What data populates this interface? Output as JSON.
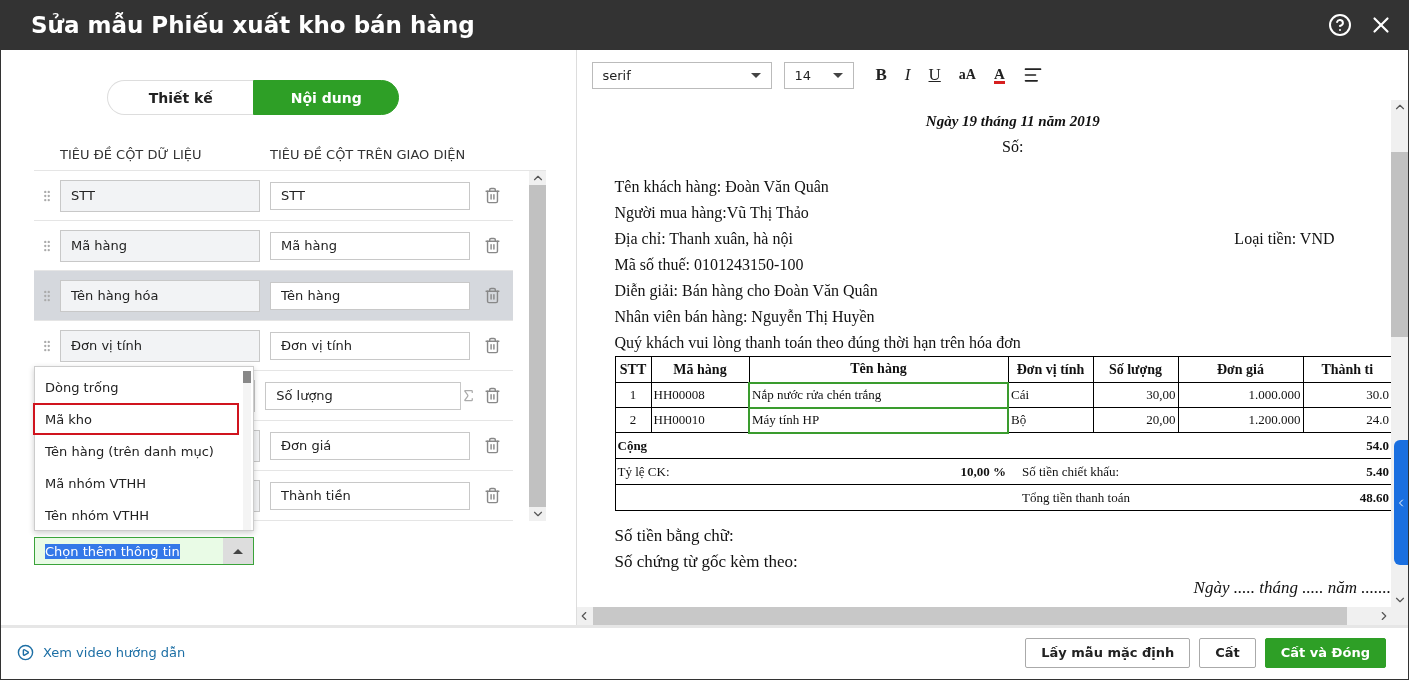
{
  "window": {
    "title": "Sửa mẫu Phiếu xuất kho bán hàng"
  },
  "mode_tabs": [
    {
      "label": "Thiết kế",
      "selected": false
    },
    {
      "label": "Nội dung",
      "selected": true
    }
  ],
  "column_headers": [
    "TIÊU ĐỀ CỘT DỮ LIỆU",
    "TIÊU ĐỀ CỘT TRÊN GIAO DIỆN"
  ],
  "rows": [
    {
      "data_field": "STT",
      "display_title": "STT",
      "selected": false,
      "sum": false
    },
    {
      "data_field": "Mã hàng",
      "display_title": "Mã hàng",
      "selected": false,
      "sum": false
    },
    {
      "data_field": "Tên hàng hóa",
      "display_title": "Tên hàng",
      "selected": true,
      "sum": false
    },
    {
      "data_field": "Đơn vị tính",
      "display_title": "Đơn vị tính",
      "selected": false,
      "sum": false
    },
    {
      "display_title": "Số lượng",
      "selected": false,
      "sum": true
    },
    {
      "display_title": "Đơn giá",
      "selected": false,
      "sum": false
    },
    {
      "display_title": "Thành tiền",
      "selected": false,
      "sum": false
    }
  ],
  "dropdown": {
    "options": [
      {
        "label": "Dòng trống",
        "selected": false
      },
      {
        "label": "Mã kho",
        "selected": true
      },
      {
        "label": "Tên hàng (trên danh mục)",
        "selected": false
      },
      {
        "label": "Mã nhóm VTHH",
        "selected": false
      },
      {
        "label": "Tên nhóm VTHH",
        "selected": false
      }
    ],
    "value": "Chọn thêm thông tin",
    "text_selected": true
  },
  "video_link": "Xem video hướng dẫn",
  "editor": {
    "font": "serif",
    "size": "14",
    "format_buttons": [
      {
        "kind": "bold",
        "label": "B"
      },
      {
        "kind": "italic",
        "label": "I"
      },
      {
        "kind": "underline",
        "label": "U"
      },
      {
        "kind": "case",
        "label": "aA"
      },
      {
        "kind": "color",
        "label": "A"
      }
    ]
  },
  "document": {
    "date": "Ngày 19 tháng 11 năm 2019",
    "number_label": "Số:",
    "info_lines": [
      {
        "text": "Tên khách hàng: Đoàn Văn Quân"
      },
      {
        "text": "Người mua hàng:Vũ Thị Thảo"
      },
      {
        "text": "Địa chỉ: Thanh xuân, hà nội",
        "aside": "Loại tiền: VND"
      },
      {
        "text": "Mã số thuế: 0101243150-100"
      },
      {
        "text": "Diễn giải: Bán hàng cho Đoàn Văn Quân"
      },
      {
        "text": "Nhân viên bán hàng: Nguyễn Thị Huyền"
      },
      {
        "text": "Quý khách vui lòng thanh toán theo đúng thời hạn trên hóa đơn"
      }
    ],
    "table": {
      "columns": [
        "STT",
        "Mã hàng",
        "Tên hàng",
        "Đơn vị tính",
        "Số lượng",
        "Đơn giá",
        "Thành ti"
      ],
      "rows": [
        [
          "1",
          "HH00008",
          "Nắp nước rửa chén trắng",
          "Cái",
          "30,00",
          "1.000.000",
          "30.0"
        ],
        [
          "2",
          "HH00010",
          "Máy tính HP",
          "Bộ",
          "20,00",
          "1.200.000",
          "24.0"
        ]
      ]
    },
    "totals": {
      "sum_label": "Cộng",
      "sum_value": "54.0",
      "discount_rate_label": "Tỷ lệ CK:",
      "discount_rate": "10,00 %",
      "discount_amount_label": "Số tiền chiết khấu:",
      "discount_amount": "5.40",
      "total_label": "Tổng tiền thanh toán",
      "total": "48.60"
    },
    "footer_lines": [
      "Số tiền bằng chữ:",
      "Số chứng từ gốc kèm theo:"
    ],
    "signature_date": "Ngày ..... tháng ..... năm ......."
  },
  "buttons": [
    {
      "label": "Lấy mẫu mặc định",
      "kind": "default"
    },
    {
      "label": "Cất",
      "kind": "default"
    },
    {
      "label": "Cất và Đóng",
      "kind": "primary"
    }
  ]
}
